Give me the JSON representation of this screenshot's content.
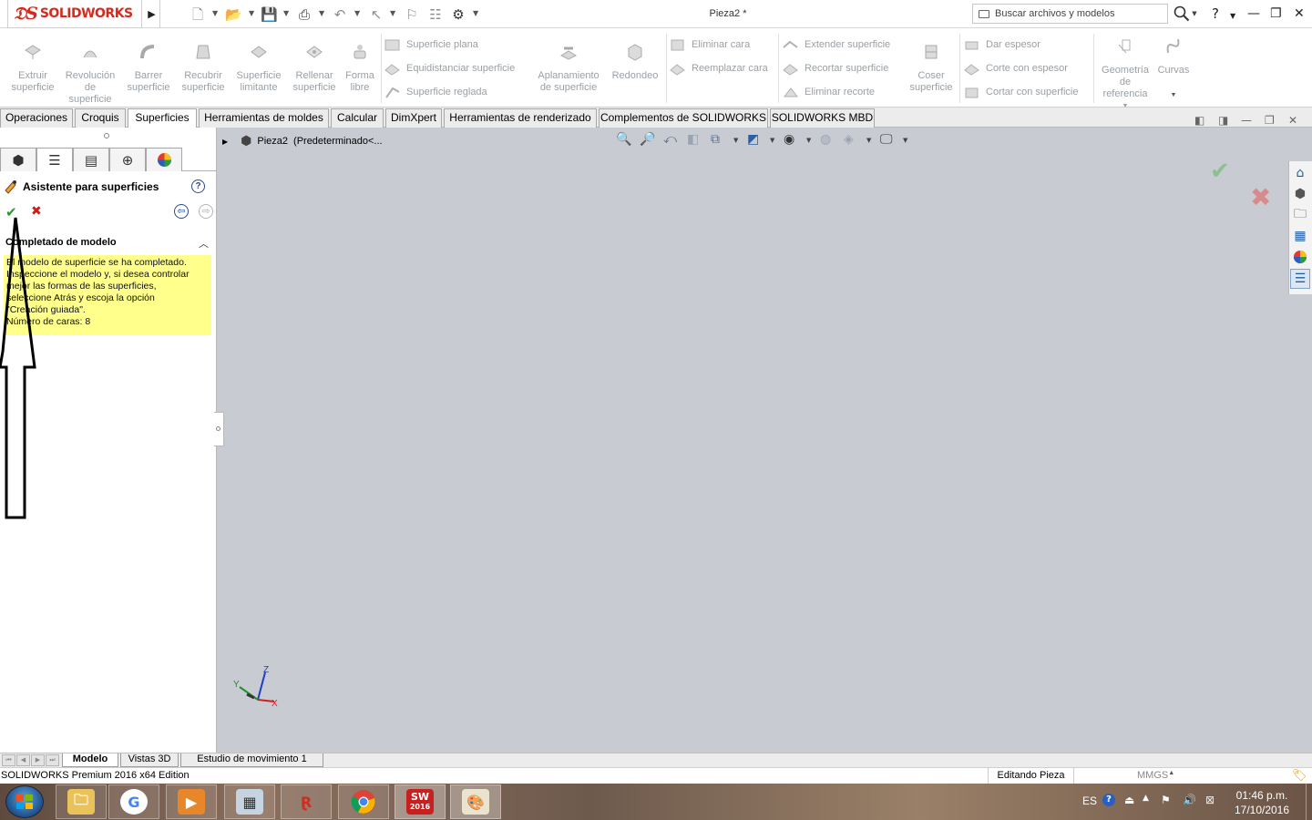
{
  "app": {
    "logo_text": "SOLIDWORKS",
    "document_title": "Pieza2 *",
    "search_placeholder": "Buscar archivos y modelos",
    "help_label": "?"
  },
  "ribbon": {
    "big_buttons": [
      {
        "label_lines": [
          "Extruir",
          "superficie"
        ]
      },
      {
        "label_lines": [
          "Revolución",
          "de",
          "superficie"
        ]
      },
      {
        "label_lines": [
          "Barrer",
          "superficie"
        ]
      },
      {
        "label_lines": [
          "Recubrir",
          "superficie"
        ]
      },
      {
        "label_lines": [
          "Superficie",
          "limitante"
        ]
      },
      {
        "label_lines": [
          "Rellenar",
          "superficie"
        ]
      },
      {
        "label_lines": [
          "Forma",
          "libre"
        ]
      },
      {
        "label_lines": [
          "Aplanamiento",
          "de superficie"
        ]
      },
      {
        "label_lines": [
          "Redondeo"
        ]
      },
      {
        "label_lines": [
          "Coser",
          "superficie"
        ]
      },
      {
        "label_lines": [
          "Geometría",
          "de",
          "referencia"
        ]
      },
      {
        "label_lines": [
          "Curvas"
        ]
      }
    ],
    "col1": [
      "Superficie plana",
      "Equidistanciar superficie",
      "Superficie reglada"
    ],
    "col2": [
      "Eliminar cara",
      "Reemplazar cara"
    ],
    "col3": [
      "Extender superficie",
      "Recortar superficie",
      "Eliminar recorte"
    ],
    "col4": [
      "Dar espesor",
      "Corte con espesor",
      "Cortar con superficie"
    ]
  },
  "tabs": [
    "Operaciones",
    "Croquis",
    "Superficies",
    "Herramientas de moldes",
    "Calcular",
    "DimXpert",
    "Herramientas de renderizado",
    "Complementos de SOLIDWORKS",
    "SOLIDWORKS MBD"
  ],
  "active_tab": "Superficies",
  "property_manager": {
    "title": "Asistente para superficies",
    "help": "?",
    "group_title": "Completado de modelo",
    "message_lines": [
      "El modelo de superficie se ha completado.",
      "Inspeccione el modelo y, si desea controlar",
      "mejor las formas de las superficies,",
      "seleccione Atrás y escoja la opción",
      "\"Creación guiada\".",
      "Número de caras: 8"
    ]
  },
  "tree": {
    "part_name": "Pieza2",
    "config": "(Predeterminado<..."
  },
  "triad": {
    "x": "X",
    "y": "Y",
    "z": "Z"
  },
  "bottom_tabs": [
    "Modelo",
    "Vistas 3D",
    "Estudio de movimiento 1"
  ],
  "status": {
    "edition": "SOLIDWORKS Premium 2016 x64 Edition",
    "editing": "Editando Pieza",
    "units": "MMGS",
    "units_arrow": "▲"
  },
  "taskbar": {
    "sw_badge_top": "SW",
    "sw_badge_year": "2016",
    "lang": "ES",
    "time": "01:46 p.m.",
    "date": "17/10/2016"
  },
  "colors": {
    "brand_red": "#d52b1e",
    "viewport": "#c9cbd3",
    "message_bg": "#ffff8c",
    "ok_green": "#2b9a2b",
    "cancel_red": "#c8201e"
  }
}
